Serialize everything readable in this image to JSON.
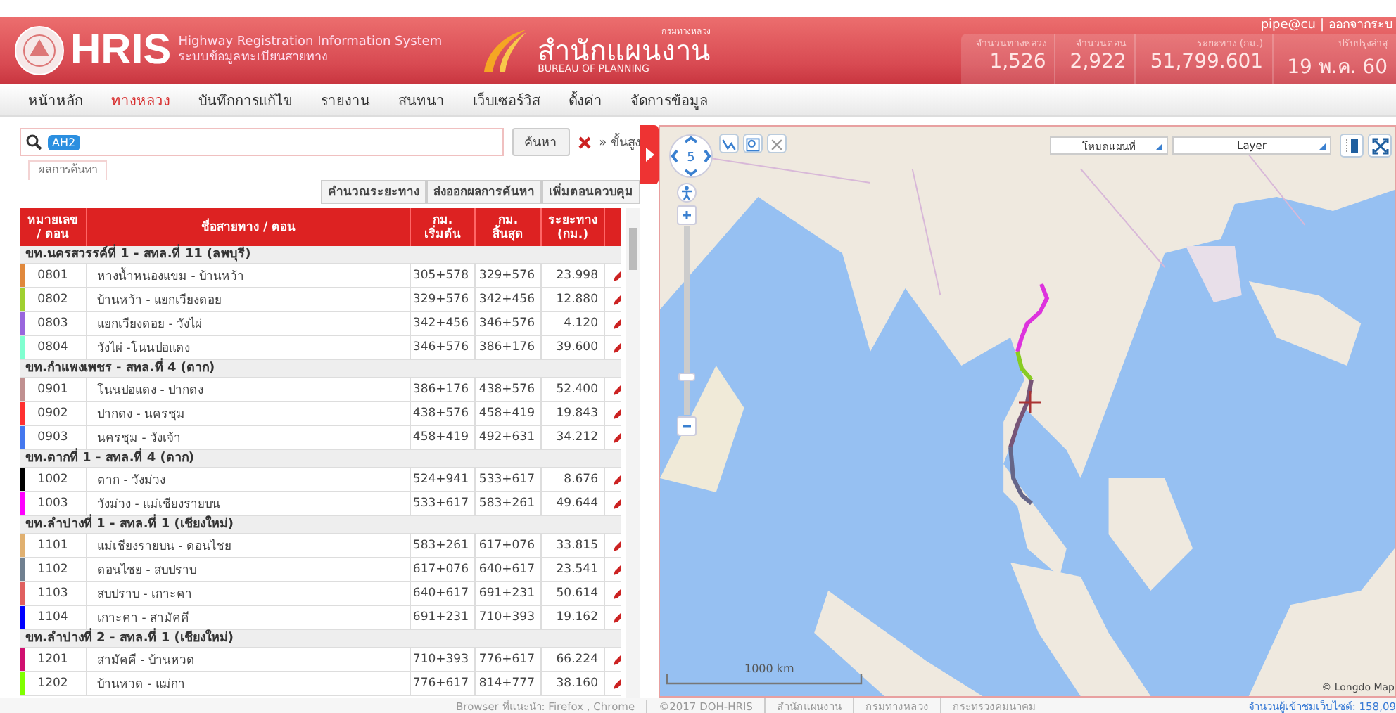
{
  "header": {
    "logo_text": "HRIS",
    "title_en": "Highway Registration Information System",
    "title_th": "ระบบข้อมูลทะเบียนสายทาง",
    "bureau_small": "กรมทางหลวง",
    "bureau_th": "สำนักแผนงาน",
    "bureau_en": "BUREAU OF PLANNING",
    "user": "pipe@cu",
    "separator": "|",
    "logout": "ออกจากระบ",
    "stats": [
      {
        "label": "จำนวนทางหลวง",
        "value": "1,526"
      },
      {
        "label": "จำนวนตอน",
        "value": "2,922"
      },
      {
        "label": "ระยะทาง (กม.)",
        "value": "51,799.601"
      },
      {
        "label": "ปรับปรุงล่าสุ",
        "value": "19 พ.ค. 60"
      }
    ]
  },
  "nav": [
    {
      "label": "หน้าหลัก",
      "selected": false
    },
    {
      "label": "ทางหลวง",
      "selected": true
    },
    {
      "label": "บันทึกการแก้ไข",
      "selected": false
    },
    {
      "label": "รายงาน",
      "selected": false
    },
    {
      "label": "สนทนา",
      "selected": false
    },
    {
      "label": "เว็บเซอร์วิส",
      "selected": false
    },
    {
      "label": "ตั้งค่า",
      "selected": false
    },
    {
      "label": "จัดการข้อมูล",
      "selected": false
    }
  ],
  "search": {
    "tag": "AH2",
    "button": "ค้นหา",
    "advanced": "» ขั้นสูง"
  },
  "results_tab": "ผลการค้นหา",
  "actions": [
    "คำนวณระยะทาง",
    "ส่งออกผลการค้นหา",
    "เพิ่มตอนควบคุม"
  ],
  "table": {
    "columns": [
      [
        "หมายเลข",
        "/ ตอน"
      ],
      [
        "ชื่อสายทาง / ตอน"
      ],
      [
        "กม.",
        "เริ่มต้น"
      ],
      [
        "กม.",
        "สิ้นสุด"
      ],
      [
        "ระยะทาง",
        "(กม.)"
      ]
    ],
    "groups": [
      {
        "title": "ขท.นครสวรรค์ที่ 1 - สทล.ที่ 11 (ลพบุรี)",
        "rows": [
          {
            "number": "0801",
            "name": "หางน้ำหนองแขม - บ้านหว้า",
            "start": "305+578",
            "end": "329+576",
            "distance": "23.998",
            "color": "#e0883c"
          },
          {
            "number": "0802",
            "name": "บ้านหว้า - แยกเวียงดอย",
            "start": "329+576",
            "end": "342+456",
            "distance": "12.880",
            "color": "#a0d030"
          },
          {
            "number": "0803",
            "name": "แยกเวียงดอย - วังไผ่",
            "start": "342+456",
            "end": "346+576",
            "distance": "4.120",
            "color": "#9966dd"
          },
          {
            "number": "0804",
            "name": "วังไผ่ -โนนปอแดง",
            "start": "346+576",
            "end": "386+176",
            "distance": "39.600",
            "color": "#80ffd0"
          }
        ]
      },
      {
        "title": "ขท.กำแพงเพชร - สทล.ที่ 4 (ตาก)",
        "rows": [
          {
            "number": "0901",
            "name": "โนนปอแดง - ปากดง",
            "start": "386+176",
            "end": "438+576",
            "distance": "52.400",
            "color": "#c09090"
          },
          {
            "number": "0902",
            "name": "ปากดง - นครชุม",
            "start": "438+576",
            "end": "458+419",
            "distance": "19.843",
            "color": "#ff3030"
          },
          {
            "number": "0903",
            "name": "นครชุม - วังเจ้า",
            "start": "458+419",
            "end": "492+631",
            "distance": "34.212",
            "color": "#4477ee"
          }
        ]
      },
      {
        "title": "ขท.ตากที่ 1 - สทล.ที่ 4 (ตาก)",
        "rows": [
          {
            "number": "1002",
            "name": "ตาก - วังม่วง",
            "start": "524+941",
            "end": "533+617",
            "distance": "8.676",
            "color": "#000000"
          },
          {
            "number": "1003",
            "name": "วังม่วง - แม่เชียงรายบน",
            "start": "533+617",
            "end": "583+261",
            "distance": "49.644",
            "color": "#ff00ff"
          }
        ]
      },
      {
        "title": "ขท.ลำปางที่ 1 - สทล.ที่ 1 (เชียงใหม่)",
        "rows": [
          {
            "number": "1101",
            "name": "แม่เชียงรายบน - ดอนไชย",
            "start": "583+261",
            "end": "617+076",
            "distance": "33.815",
            "color": "#e0b070"
          },
          {
            "number": "1102",
            "name": "ดอนไชย - สบปราบ",
            "start": "617+076",
            "end": "640+617",
            "distance": "23.541",
            "color": "#708090"
          },
          {
            "number": "1103",
            "name": "สบปราบ - เกาะคา",
            "start": "640+617",
            "end": "691+231",
            "distance": "50.614",
            "color": "#e06060"
          },
          {
            "number": "1104",
            "name": "เกาะคา - สามัคคี",
            "start": "691+231",
            "end": "710+393",
            "distance": "19.162",
            "color": "#0000ff"
          }
        ]
      },
      {
        "title": "ขท.ลำปางที่ 2 - สทล.ที่ 1 (เชียงใหม่)",
        "rows": [
          {
            "number": "1201",
            "name": "สามัคคี - บ้านหวด",
            "start": "710+393",
            "end": "776+617",
            "distance": "66.224",
            "color": "#d01070"
          },
          {
            "number": "1202",
            "name": "บ้านหวด - แม่กา",
            "start": "776+617",
            "end": "814+777",
            "distance": "38.160",
            "color": "#80ff00"
          }
        ]
      }
    ]
  },
  "map": {
    "zoom_level": "5",
    "zoom_slider": {
      "level": 0.2
    },
    "mode_select": "โหมดแผนที่",
    "layer_select": "Layer",
    "scale": "1000 km",
    "attribution": "© Longdo Map"
  },
  "footer": {
    "items": [
      "Browser ที่แนะนำ: Firefox , Chrome",
      "©2017 DOH-HRIS",
      "สำนักแผนงาน",
      "กรมทางหลวง",
      "กระทรวงคมนาคม"
    ],
    "visitors": "จำนวนผู้เข้าชมเว็บไซต์: 158,09"
  }
}
